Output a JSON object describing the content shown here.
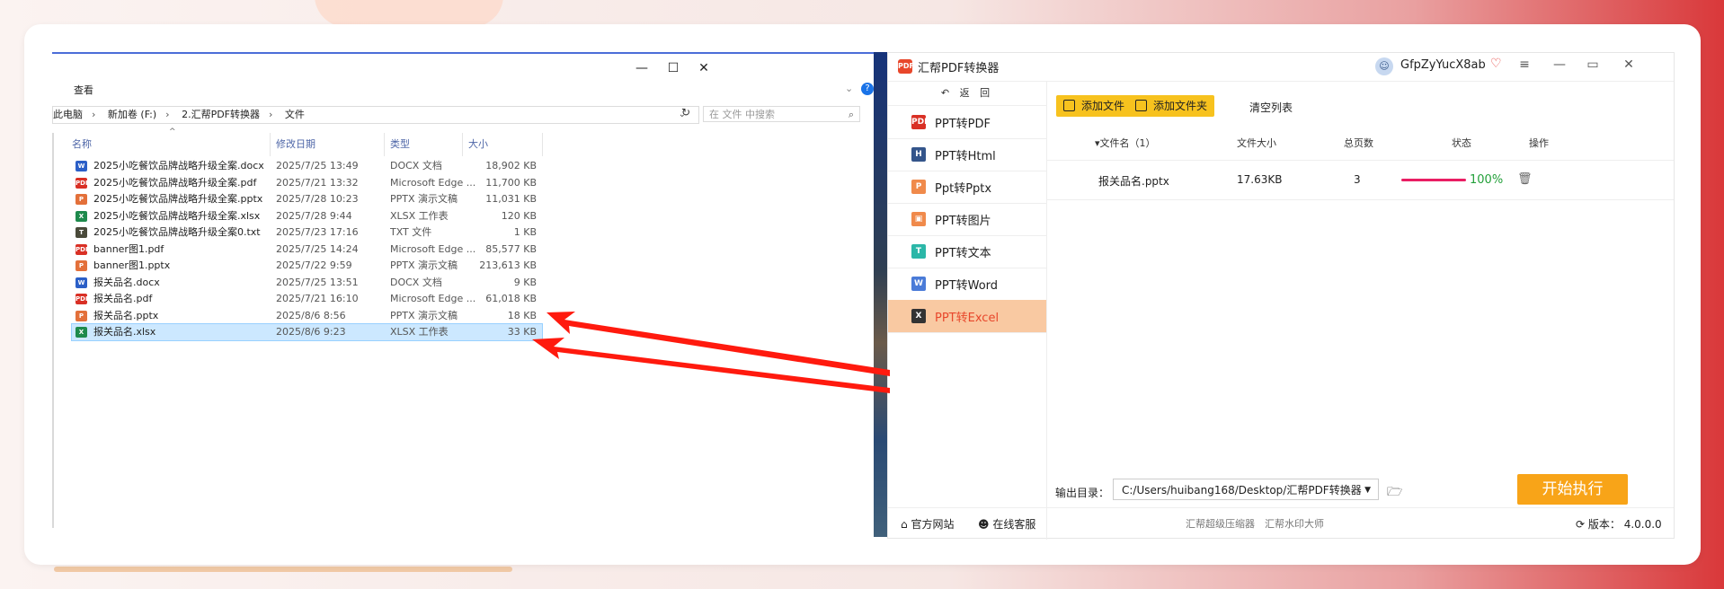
{
  "explorer": {
    "window_controls": [
      "—",
      "☐",
      "✕"
    ],
    "menu_label": "查看",
    "address_parts": [
      "此电脑",
      "新加卷 (F:)",
      "2.汇帮PDF转换器",
      "文件"
    ],
    "search_placeholder": "在 文件 中搜索",
    "columns": {
      "name": "名称",
      "date": "修改日期",
      "type": "类型",
      "size": "大小"
    },
    "files": [
      {
        "icon": "W",
        "icon_color": "#2b5fc7",
        "name": "2025小吃餐饮品牌战略升级全案.docx",
        "date": "2025/7/25 13:49",
        "type": "DOCX 文档",
        "size": "18,902 KB"
      },
      {
        "icon": "PDF",
        "icon_color": "#d93025",
        "name": "2025小吃餐饮品牌战略升级全案.pdf",
        "date": "2025/7/21 13:32",
        "type": "Microsoft Edge ...",
        "size": "11,700 KB"
      },
      {
        "icon": "P",
        "icon_color": "#e3703a",
        "name": "2025小吃餐饮品牌战略升级全案.pptx",
        "date": "2025/7/28 10:23",
        "type": "PPTX 演示文稿",
        "size": "11,031 KB"
      },
      {
        "icon": "X",
        "icon_color": "#1e8a4c",
        "name": "2025小吃餐饮品牌战略升级全案.xlsx",
        "date": "2025/7/28 9:44",
        "type": "XLSX 工作表",
        "size": "120 KB"
      },
      {
        "icon": "T",
        "icon_color": "#4a4a3a",
        "name": "2025小吃餐饮品牌战略升级全案0.txt",
        "date": "2025/7/23 17:16",
        "type": "TXT 文件",
        "size": "1 KB"
      },
      {
        "icon": "PDF",
        "icon_color": "#d93025",
        "name": "banner图1.pdf",
        "date": "2025/7/25 14:24",
        "type": "Microsoft Edge ...",
        "size": "85,577 KB"
      },
      {
        "icon": "P",
        "icon_color": "#e3703a",
        "name": "banner图1.pptx",
        "date": "2025/7/22 9:59",
        "type": "PPTX 演示文稿",
        "size": "213,613 KB"
      },
      {
        "icon": "W",
        "icon_color": "#2b5fc7",
        "name": "报关品名.docx",
        "date": "2025/7/25 13:51",
        "type": "DOCX 文档",
        "size": "9 KB"
      },
      {
        "icon": "PDF",
        "icon_color": "#d93025",
        "name": "报关品名.pdf",
        "date": "2025/7/21 16:10",
        "type": "Microsoft Edge ...",
        "size": "61,018 KB"
      },
      {
        "icon": "P",
        "icon_color": "#e3703a",
        "name": "报关品名.pptx",
        "date": "2025/8/6 8:56",
        "type": "PPTX 演示文稿",
        "size": "18 KB"
      },
      {
        "icon": "X",
        "icon_color": "#1e8a4c",
        "name": "报关品名.xlsx",
        "date": "2025/8/6 9:23",
        "type": "XLSX 工作表",
        "size": "33 KB",
        "selected": true
      }
    ]
  },
  "app": {
    "title": "汇帮PDF转换器",
    "username": "GfpZyYucX8ab",
    "back_label": "返 回",
    "nav": [
      {
        "label": "PPT转PDF",
        "icon": "PDF",
        "color": "#d93025"
      },
      {
        "label": "PPT转Html",
        "icon": "H",
        "color": "#34558b"
      },
      {
        "label": "Ppt转Pptx",
        "icon": "P",
        "color": "#f08a4b"
      },
      {
        "label": "PPT转图片",
        "icon": "▣",
        "color": "#f08a4b"
      },
      {
        "label": "PPT转文本",
        "icon": "T",
        "color": "#2bb7a8"
      },
      {
        "label": "PPT转Word",
        "icon": "W",
        "color": "#4a7bd8"
      },
      {
        "label": "PPT转Excel",
        "icon": "X",
        "color": "#333333",
        "active": true
      }
    ],
    "add_file": "添加文件",
    "add_folder": "添加文件夹",
    "clear_list": "清空列表",
    "table_headers": {
      "name": "▾文件名（1）",
      "size": "文件大小",
      "pages": "总页数",
      "status": "状态",
      "action": "操作"
    },
    "file_row": {
      "name": "报关品名.pptx",
      "size": "17.63KB",
      "pages": "3",
      "progress": 1.0,
      "progress_label": "100%"
    },
    "output_label": "输出目录：",
    "output_path": "C:/Users/huibang168/Desktop/汇帮PDF转换器",
    "start_button": "开始执行",
    "footer": {
      "website": "官方网站",
      "support": "在线客服",
      "compressor": "汇帮超级压缩器",
      "watermark": "汇帮水印大师",
      "version": "版本：  4.0.0.0"
    }
  },
  "colors": {
    "accent_orange": "#f8a418",
    "accent_yellow": "#f7c21e",
    "active_nav_bg": "#f9c9a2",
    "arrow_red": "#ff1a0e",
    "success_green": "#23a03a"
  }
}
